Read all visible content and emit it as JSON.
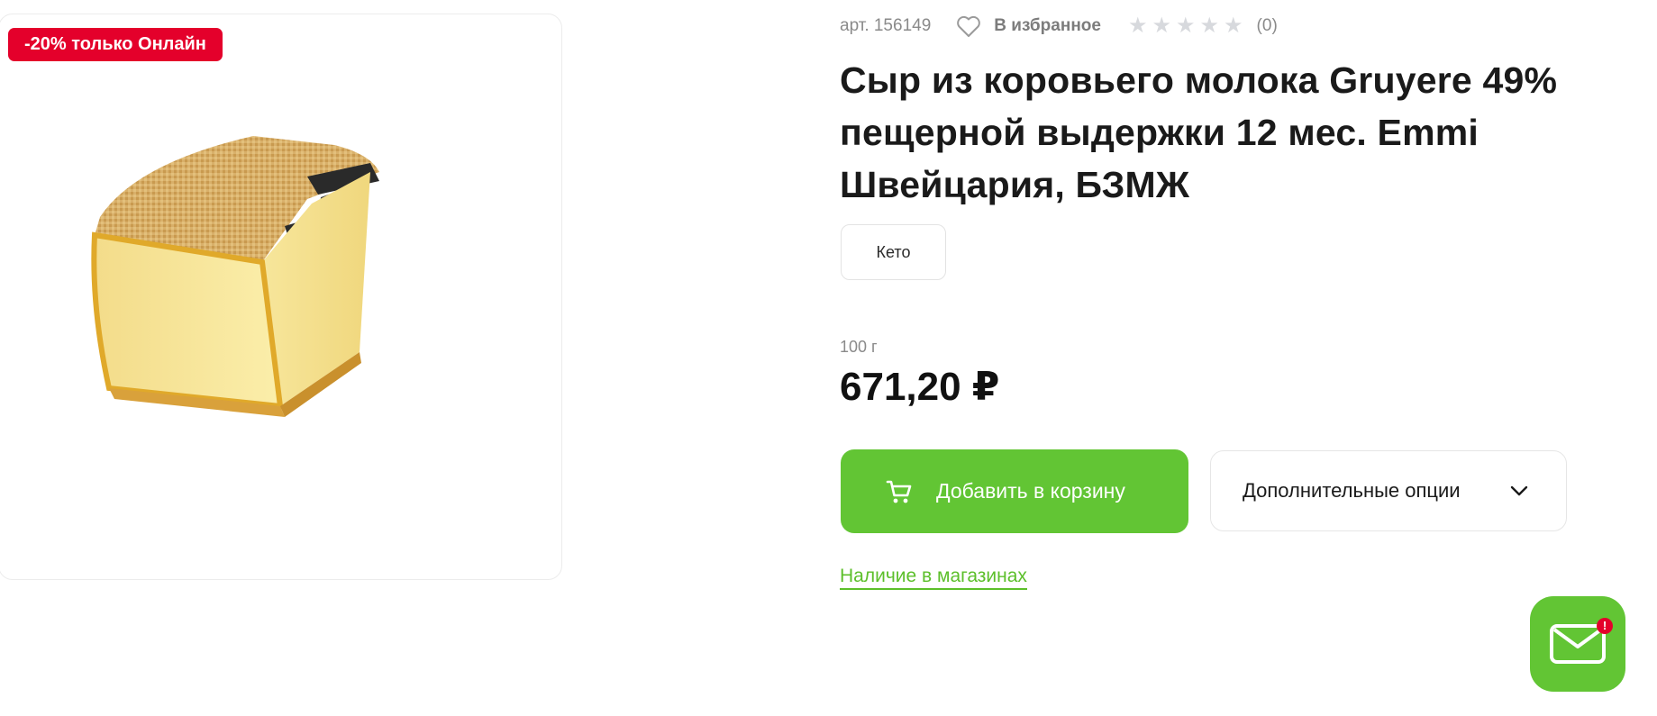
{
  "promo": {
    "badge": "-20% только Онлайн"
  },
  "product": {
    "sku": "арт. 156149",
    "favorite_label": "В избранное",
    "rating": {
      "stars": 0,
      "max": 5,
      "review_count": "(0)"
    },
    "title": "Сыр из коровьего молока Gruyere 49% пещерной выдержки 12 мес. Emmi Швейцария, БЗМЖ",
    "tags": [
      "Кето"
    ],
    "weight": "100 г",
    "price": "671,20 ₽"
  },
  "actions": {
    "add_to_cart": "Добавить в корзину",
    "more_options": "Дополнительные опции",
    "stores_availability": "Наличие в магазинах"
  },
  "chat": {
    "badge": "!"
  },
  "colors": {
    "accent_green": "#62c534",
    "promo_red": "#e4002b",
    "link_green": "#5cbf2a"
  },
  "icons": {
    "favorite": "heart-outline-icon",
    "star": "star-icon",
    "cart": "cart-icon",
    "chevron": "chevron-down-icon",
    "chat": "envelope-icon"
  }
}
